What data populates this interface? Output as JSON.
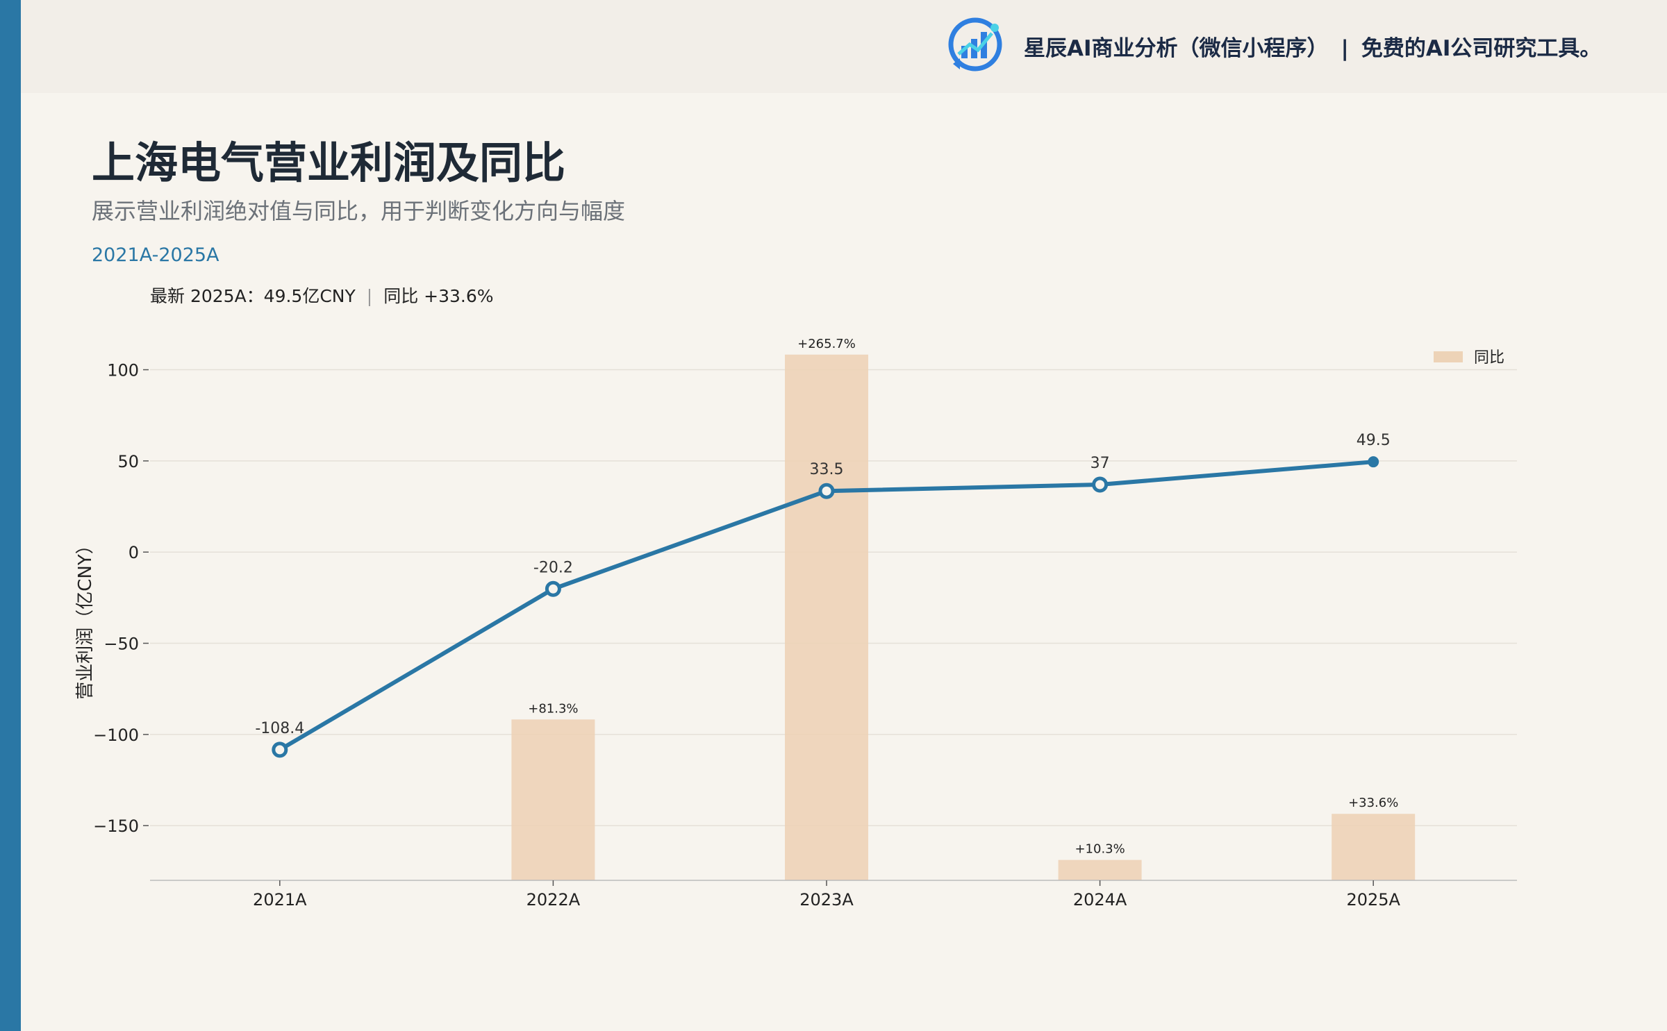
{
  "brand": {
    "name": "星辰AI商业分析（微信小程序）",
    "separator": "|",
    "tagline": "免费的AI公司研究工具。",
    "logo_icon": "bar-chart-circle-logo"
  },
  "header": {
    "title": "上海电气营业利润及同比",
    "subtitle": "展示营业利润绝对值与同比，用于判断变化方向与幅度",
    "range": "2021A-2025A"
  },
  "latest": {
    "left": "最新 2025A：49.5亿CNY",
    "sep": "|",
    "right": "同比 +33.6%"
  },
  "colors": {
    "line": "#2a77a5",
    "bar": "#edd3b7",
    "accent": "#2a77a5",
    "background": "#f7f4ee"
  },
  "chart_data": {
    "type": "bar+line",
    "categories": [
      "2021A",
      "2022A",
      "2023A",
      "2024A",
      "2025A"
    ],
    "series": [
      {
        "kind": "line",
        "values": [
          -108.4,
          -20.2,
          33.5,
          37,
          49.5
        ],
        "labels": [
          "-108.4",
          "-20.2",
          "33.5",
          "37",
          "49.5"
        ]
      },
      {
        "name": "同比",
        "kind": "bar",
        "values": [
          null,
          81.3,
          265.7,
          10.3,
          33.6
        ],
        "labels": [
          "",
          "+81.3%",
          "+265.7%",
          "+10.3%",
          "+33.6%"
        ]
      }
    ],
    "ylabel": "营业利润（亿CNY）",
    "ylim": [
      -180,
      120
    ],
    "yticks": [
      100,
      50,
      0,
      -50,
      -100,
      -150
    ],
    "ytick_labels": [
      "100",
      "50",
      "0",
      "−50",
      "−100",
      "−150"
    ],
    "bar_ylim": [
      0,
      280
    ],
    "grid": true,
    "legend": "top-right"
  }
}
